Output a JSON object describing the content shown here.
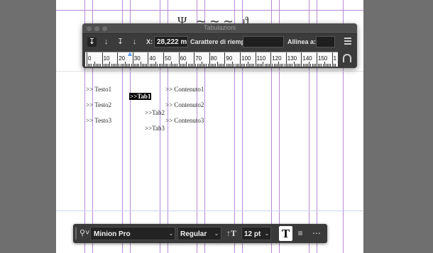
{
  "tabs_panel": {
    "title": "Tabulazioni",
    "x_label": "X:",
    "x_value": "28,222 m",
    "leader_label": "Carattere di riemp.:",
    "leader_value": "",
    "align_label": "Allinea a:",
    "align_value": "",
    "ruler_numbers": [
      "0",
      "10",
      "20",
      "30",
      "40",
      "50",
      "60",
      "70",
      "80",
      "90",
      "100",
      "110",
      "120",
      "130",
      "140",
      "150",
      "1"
    ],
    "tab_stop_mm": 28.222,
    "icons": [
      "left-tab-icon",
      "center-tab-icon",
      "right-tab-icon",
      "decimal-tab-icon",
      "panel-menu-icon",
      "magnet-icon"
    ]
  },
  "document": {
    "lines": [
      {
        "col1": ">> Testo1",
        "col2": ">>Tab1",
        "col3": ">> Contenuto1"
      },
      {
        "col1": ">> Testo2",
        "col2": ">>Tab2",
        "col3": ">> Contenuto2"
      },
      {
        "col1": ">> Testo3",
        "col2": ">>Tab3",
        "col3": ">> Contenuto3"
      }
    ],
    "guide_color": "#b58ad6"
  },
  "control_bar": {
    "font_family": "Minion Pro",
    "font_style": "Regular",
    "font_size": "12 pt",
    "type_button": "T",
    "icons": [
      "search-icon",
      "font-size-icon",
      "type-on-icon",
      "align-icon",
      "more-icon"
    ]
  }
}
